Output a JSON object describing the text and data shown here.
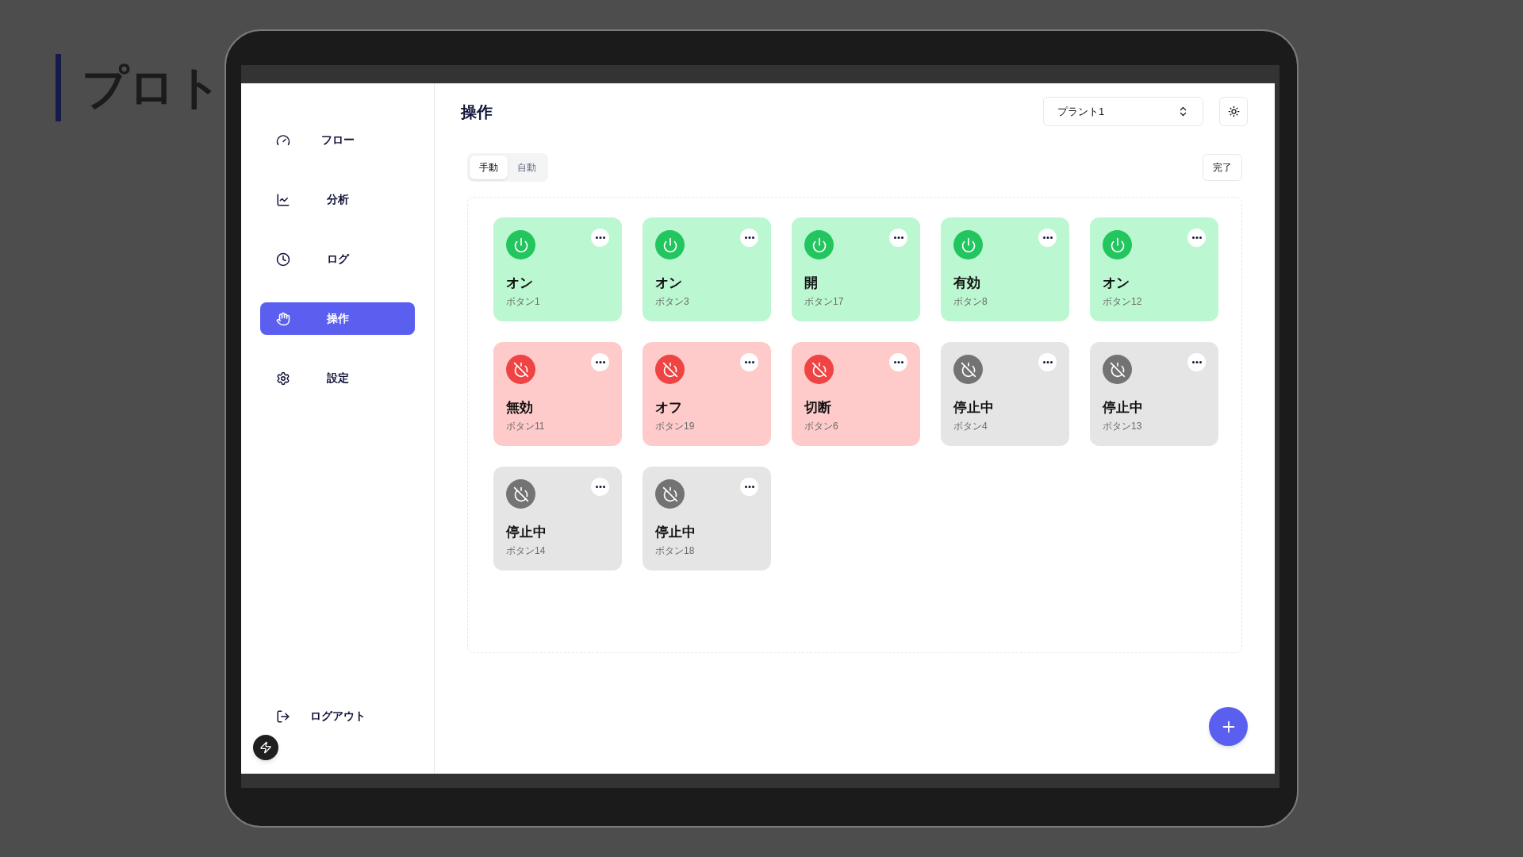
{
  "backdrop_title": "プロト",
  "sidebar": {
    "items": [
      {
        "label": "フロー",
        "selected": false
      },
      {
        "label": "分析",
        "selected": false
      },
      {
        "label": "ログ",
        "selected": false
      },
      {
        "label": "操作",
        "selected": true
      },
      {
        "label": "設定",
        "selected": false
      }
    ],
    "logout": "ログアウト"
  },
  "header": {
    "title": "操作",
    "plant_select": {
      "value": "プラント1"
    }
  },
  "mode_tabs": [
    {
      "label": "手動",
      "selected": true
    },
    {
      "label": "自動",
      "selected": false
    }
  ],
  "done_button": "完了",
  "cards": [
    {
      "label": "オン",
      "name": "ボタン1",
      "kind": "on"
    },
    {
      "label": "オン",
      "name": "ボタン3",
      "kind": "on"
    },
    {
      "label": "開",
      "name": "ボタン17",
      "kind": "on"
    },
    {
      "label": "有効",
      "name": "ボタン8",
      "kind": "on"
    },
    {
      "label": "オン",
      "name": "ボタン12",
      "kind": "on"
    },
    {
      "label": "無効",
      "name": "ボタン11",
      "kind": "off"
    },
    {
      "label": "オフ",
      "name": "ボタン19",
      "kind": "off"
    },
    {
      "label": "切断",
      "name": "ボタン6",
      "kind": "off"
    },
    {
      "label": "停止中",
      "name": "ボタン4",
      "kind": "stopped"
    },
    {
      "label": "停止中",
      "name": "ボタン13",
      "kind": "stopped"
    },
    {
      "label": "停止中",
      "name": "ボタン14",
      "kind": "stopped"
    },
    {
      "label": "停止中",
      "name": "ボタン18",
      "kind": "stopped"
    }
  ]
}
